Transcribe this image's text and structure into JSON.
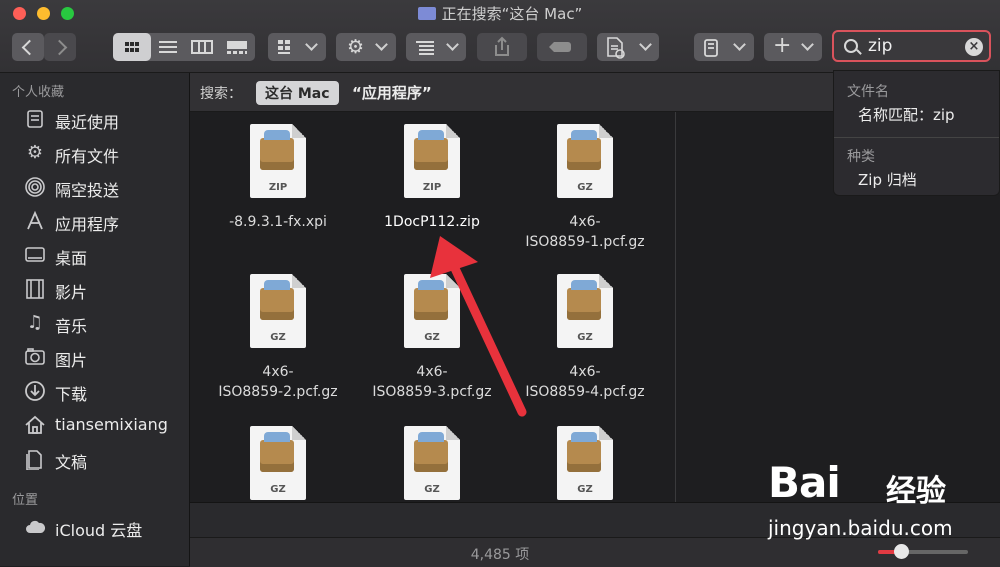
{
  "window": {
    "title": "正在搜索“这台 Mac”"
  },
  "search": {
    "query": "zip"
  },
  "sidebar": {
    "favorites_header": "个人收藏",
    "items": [
      {
        "label": "最近使用",
        "icon": "recents-icon"
      },
      {
        "label": "所有文件",
        "icon": "gear-icon"
      },
      {
        "label": "隔空投送",
        "icon": "airdrop-icon"
      },
      {
        "label": "应用程序",
        "icon": "applications-icon"
      },
      {
        "label": "桌面",
        "icon": "desktop-icon"
      },
      {
        "label": "影片",
        "icon": "movies-icon"
      },
      {
        "label": "音乐",
        "icon": "music-icon"
      },
      {
        "label": "图片",
        "icon": "pictures-icon"
      },
      {
        "label": "下载",
        "icon": "downloads-icon"
      },
      {
        "label": "tiansemixiang",
        "icon": "home-icon"
      },
      {
        "label": "文稿",
        "icon": "documents-icon"
      }
    ],
    "locations_header": "位置",
    "locations": [
      {
        "label": "iCloud 云盘",
        "icon": "icloud-icon"
      }
    ]
  },
  "scope": {
    "label": "搜索：",
    "this_mac": "这台 Mac",
    "apps": "“应用程序”"
  },
  "files": [
    {
      "name": [
        "-8.9.3.1-fx.xpi"
      ],
      "type": "ZIP"
    },
    {
      "name": [
        "1DocP112.zip"
      ],
      "type": "ZIP"
    },
    {
      "name": [
        "4x6-",
        "ISO8859-1.pcf.gz"
      ],
      "type": "GZ"
    },
    {
      "name": [
        "4x6-",
        "ISO8859-2.pcf.gz"
      ],
      "type": "GZ"
    },
    {
      "name": [
        "4x6-",
        "ISO8859-3.pcf.gz"
      ],
      "type": "GZ"
    },
    {
      "name": [
        "4x6-",
        "ISO8859-4.pcf.gz"
      ],
      "type": "GZ"
    },
    {
      "name": [],
      "type": "GZ"
    },
    {
      "name": [],
      "type": "GZ"
    },
    {
      "name": [],
      "type": "GZ"
    }
  ],
  "dropdown": {
    "filename_header": "文件名",
    "filename_item": "名称匹配：zip",
    "kind_header": "种类",
    "kind_item": "Zip 归档"
  },
  "status": {
    "count": "4,485 项",
    "zoom": 0.25
  },
  "colors": {
    "accent": "#e23a42",
    "search_focus": "#d9535c"
  },
  "watermark": {
    "brand": "Bai",
    "sub": "经验",
    "url": "jingyan.baidu.com"
  }
}
